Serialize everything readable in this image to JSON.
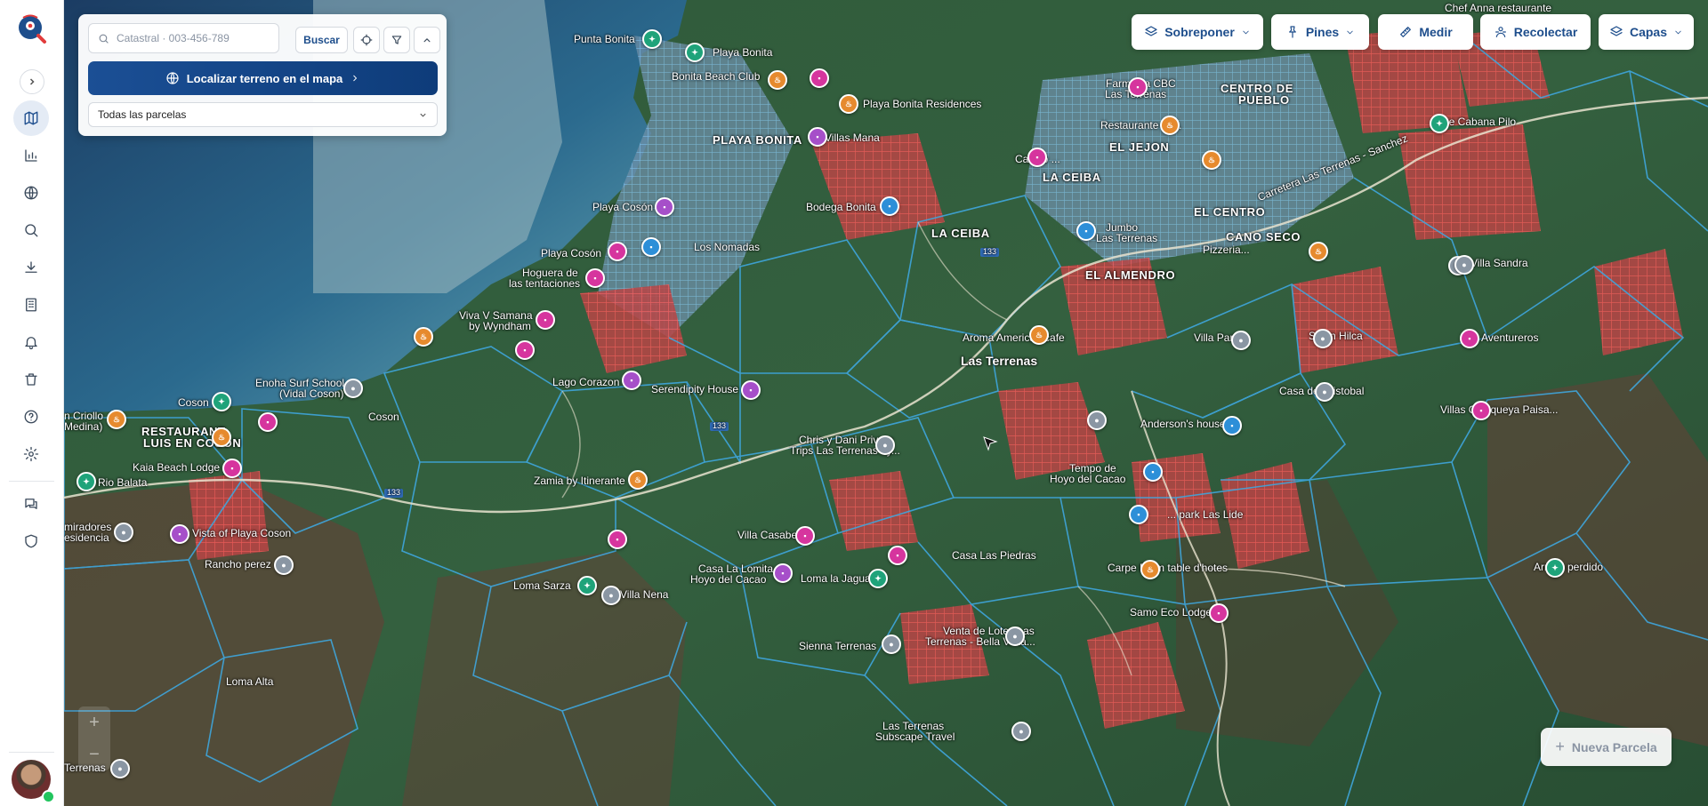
{
  "search": {
    "placeholder": "Catastral · 003-456-789",
    "button_label": "Buscar"
  },
  "locate_button_label": "Localizar terreno en el mapa",
  "parcel_filter": {
    "selected": "Todas las parcelas"
  },
  "toolbar": {
    "sobreponer": "Sobreponer",
    "pines": "Pines",
    "medir": "Medir",
    "recolectar": "Recolectar",
    "capas": "Capas"
  },
  "new_parcel_label": "Nueva Parcela",
  "zoom": {
    "in": "+",
    "out": "−"
  },
  "sidebar_icons": [
    "map-icon",
    "chart-icon",
    "globe-icon",
    "search-icon",
    "download-icon",
    "building-icon",
    "bell-icon",
    "trash-icon",
    "help-icon",
    "settings-icon",
    "chat-icon",
    "shield-icon"
  ],
  "colors": {
    "brand": "#1e4e8c",
    "parcel_red": "#e23b3b",
    "parcel_blue": "#3fa6dd"
  },
  "map_labels": {
    "punta_bonita": "Punta Bonita",
    "playa_bonita": "Playa Bonita",
    "beach_club": "Bonita Beach Club",
    "playa_bonita_residences": "Playa Bonita Residences",
    "villas_mana": "Villas Mana",
    "playa_bonita_area": "PLAYA BONITA",
    "bodega_bonita": "Bodega Bonita",
    "playa_coson_1": "Playa Cosón",
    "los_nomadas": "Los Nomadas",
    "playa_coson_2": "Playa Cosón",
    "hoguera_1": "Hoguera de",
    "hoguera_2": "las tentaciones",
    "viva_1": "Viva V Samana",
    "viva_2": "by Wyndham",
    "lago_corazon": "Lago Corazon",
    "serendipity": "Serendipity House",
    "enoha_1": "Enoha Surf School",
    "enoha_2": "(Vidal Coson)",
    "coson_1": "Coson",
    "coson_2": "Coson",
    "criollo_1": "n Criollo",
    "criollo_2": "Medina)",
    "restaurant_1": "RESTAURANT",
    "restaurant_2": "LUIS EN COSON",
    "kaia": "Kaia Beach Lodge",
    "rio_balata": "Rio Balata",
    "residencias_1": "miradores",
    "residencias_2": "esidencia",
    "vista_playa_coson": "Vista of Playa Coson",
    "rancho_perez": "Rancho perez",
    "zamia": "Zamia by Itinerante",
    "loma_sarza": "Loma Sarza",
    "villa_nena": "Villa Nena",
    "casa_lomita_1": "Casa La Lomita",
    "casa_lomita_2": "Hoyo del Cacao",
    "villa_casabe": "Villa Casabe",
    "loma_jagua": "Loma la Jagua",
    "chris_dani_1": "Chris y Dani Private",
    "chris_dani_2": "Trips Las Terrenas by...",
    "aroma": "Aroma American cafe",
    "las_terrenas": "Las Terrenas",
    "la_ceiba_1": "LA CEIBA",
    "la_ceiba_2": "LA CEIBA",
    "casa_piedras": "Casa Las Piedras",
    "loma_alta": "Loma Alta",
    "sienna": "Sienna Terrenas",
    "venta_lotes_1": "Venta de Lotes Las",
    "venta_lotes_2": "Terrenas - Bella Vista...",
    "subscape_1": "Las Terrenas",
    "subscape_2": "Subscape Travel",
    "terrenas_sw": "Terrenas",
    "casino": "Casino ...",
    "el_centro": "EL CENTRO",
    "el_almendro": "EL ALMENDRO",
    "canosico": "CANO SECO",
    "pizzeria": "Pizzeria...",
    "farmacia_1": "Farmacia CBC",
    "farmacia_2": "Las Terrenas",
    "centro_pueblo_1": "CENTRO DE",
    "centro_pueblo_2": "PUEBLO",
    "restaurante_el": "Restaurante el ...",
    "el_jejon": "EL JEJON",
    "jumbo_1": "Jumbo",
    "jumbo_2": "Las Terrenas",
    "carretera": "Carretera Las Terrenas - Sanchez",
    "villa_paris": "Villa Paris",
    "salon_hilca": "Salon Hilca",
    "casa_cristobal": "Casa de Cristobal",
    "andersons": "Anderson's house",
    "tempo_1": "Tempo de",
    "tempo_2": "Hoyo del Cacao",
    "park": "... park Las Lide",
    "carpe_diem": "Carpe Diem table d'hotes",
    "samo": "Samo Eco Lodge",
    "villa_sandra": "Villa Sandra",
    "aventureros": "Aventureros",
    "villas_quisqueya": "Villas Quisqueya Paisa...",
    "arrollo_perdido": "Arrollo perdido",
    "chef_anna": "Chef Anna restaurante",
    "le_cabana": "Le Cabana Pilo",
    "route_133_a": "133",
    "route_133_b": "133",
    "route_133_c": "133"
  }
}
